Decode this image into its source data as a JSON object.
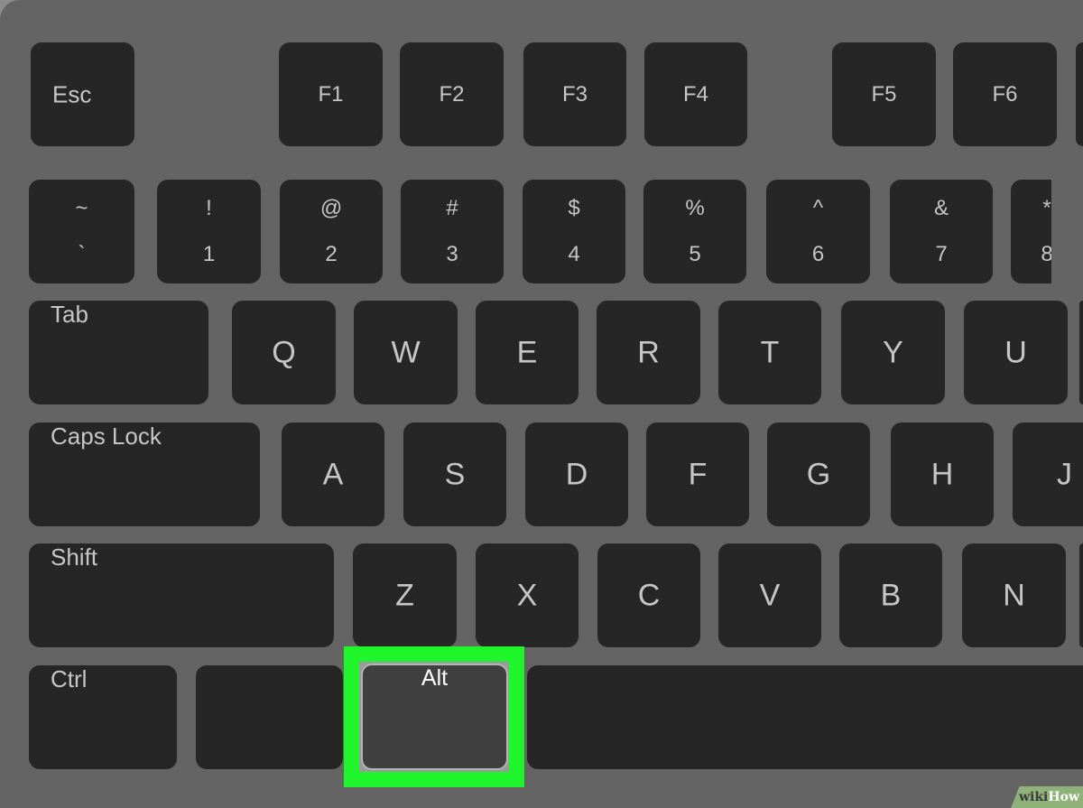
{
  "rows": [
    [
      {
        "label": "Esc"
      },
      {
        "label": "F1"
      },
      {
        "label": "F2"
      },
      {
        "label": "F3"
      },
      {
        "label": "F4"
      },
      {
        "label": "F5"
      },
      {
        "label": "F6"
      },
      {
        "label": ""
      }
    ],
    [
      {
        "top": "~",
        "bottom": "`"
      },
      {
        "top": "!",
        "bottom": "1"
      },
      {
        "top": "@",
        "bottom": "2"
      },
      {
        "top": "#",
        "bottom": "3"
      },
      {
        "top": "$",
        "bottom": "4"
      },
      {
        "top": "%",
        "bottom": "5"
      },
      {
        "top": "^",
        "bottom": "6"
      },
      {
        "top": "&",
        "bottom": "7"
      },
      {
        "top": "*",
        "bottom": "8"
      }
    ],
    [
      {
        "label": "Tab"
      },
      {
        "label": "Q"
      },
      {
        "label": "W"
      },
      {
        "label": "E"
      },
      {
        "label": "R"
      },
      {
        "label": "T"
      },
      {
        "label": "Y"
      },
      {
        "label": "U"
      },
      {
        "label": ""
      }
    ],
    [
      {
        "label": "Caps Lock"
      },
      {
        "label": "A"
      },
      {
        "label": "S"
      },
      {
        "label": "D"
      },
      {
        "label": "F"
      },
      {
        "label": "G"
      },
      {
        "label": "H"
      },
      {
        "label": "J"
      }
    ],
    [
      {
        "label": "Shift"
      },
      {
        "label": "Z"
      },
      {
        "label": "X"
      },
      {
        "label": "C"
      },
      {
        "label": "V"
      },
      {
        "label": "B"
      },
      {
        "label": "N"
      },
      {
        "label": ""
      }
    ],
    [
      {
        "label": "Ctrl"
      },
      {
        "label": ""
      },
      {
        "label": "Alt",
        "highlighted": true
      },
      {
        "label": ""
      }
    ]
  ],
  "highlight_color": "#1ef52a",
  "watermark": {
    "part1": "wiki",
    "part2": "How"
  }
}
